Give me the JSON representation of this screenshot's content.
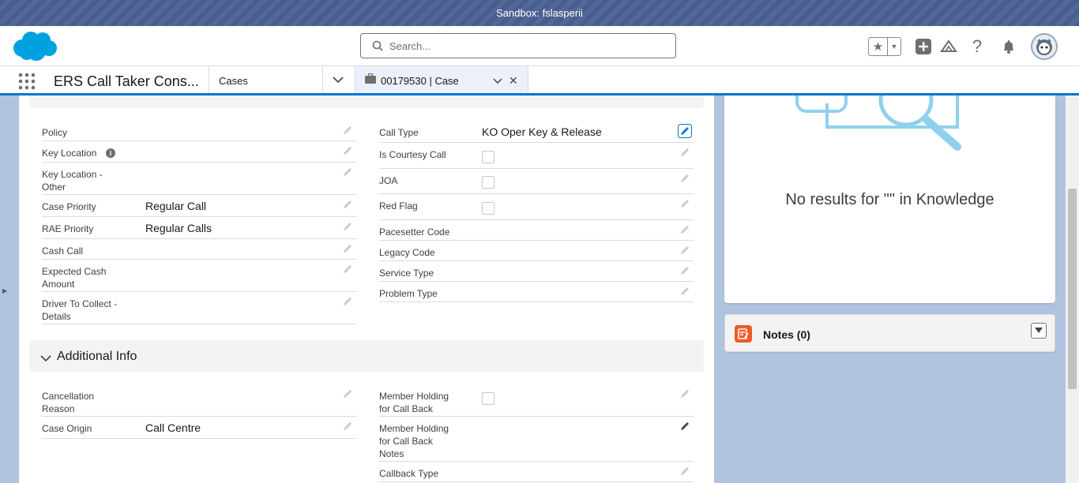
{
  "sandbox": {
    "label": "Sandbox: fslasperii"
  },
  "header": {
    "search_placeholder": "Search...",
    "icons": [
      "favorites-star-icon",
      "favorites-dropdown-icon",
      "global-actions-plus-icon",
      "trailhead-icon",
      "help-icon",
      "notifications-bell-icon",
      "user-avatar"
    ]
  },
  "nav": {
    "app_name": "ERS Call Taker Cons...",
    "tab_cases": "Cases",
    "workspace_tab": "00179530 | Case"
  },
  "details": {
    "left": [
      {
        "label": "Policy",
        "value": ""
      },
      {
        "label": "Key Location",
        "value": ""
      },
      {
        "label": "Key Location - Other",
        "value": ""
      },
      {
        "label": "Case Priority",
        "value": "Regular Call"
      },
      {
        "label": "RAE Priority",
        "value": "Regular Calls"
      },
      {
        "label": "Cash Call",
        "value": ""
      },
      {
        "label": "Expected Cash Amount",
        "value": ""
      },
      {
        "label": "Driver To Collect - Details",
        "value": ""
      }
    ],
    "right": [
      {
        "label": "Call Type",
        "value": "KO Oper Key & Release"
      },
      {
        "label": "Is Courtesy Call",
        "checked": false
      },
      {
        "label": "JOA",
        "checked": false
      },
      {
        "label": "Red Flag",
        "checked": false
      },
      {
        "label": "Pacesetter Code",
        "value": ""
      },
      {
        "label": "Legacy Code",
        "value": ""
      },
      {
        "label": "Service Type",
        "value": ""
      },
      {
        "label": "Problem Type",
        "value": ""
      }
    ]
  },
  "additional": {
    "title": "Additional Info",
    "left": [
      {
        "label": "Cancellation Reason",
        "value": ""
      },
      {
        "label": "Case Origin",
        "value": "Call Centre"
      }
    ],
    "right": [
      {
        "label": "Member Holding for Call Back",
        "checked": false
      },
      {
        "label": "Member Holding for Call Back Notes",
        "value": ""
      },
      {
        "label": "Callback Type",
        "value": ""
      }
    ]
  },
  "knowledge": {
    "no_results": "No results for \"\" in Knowledge"
  },
  "notes": {
    "title": "Notes (0)"
  },
  "colors": {
    "brand": "#0176d3",
    "notes_icon": "#f05a29",
    "sandbox_banner": "#4a5e8c"
  }
}
